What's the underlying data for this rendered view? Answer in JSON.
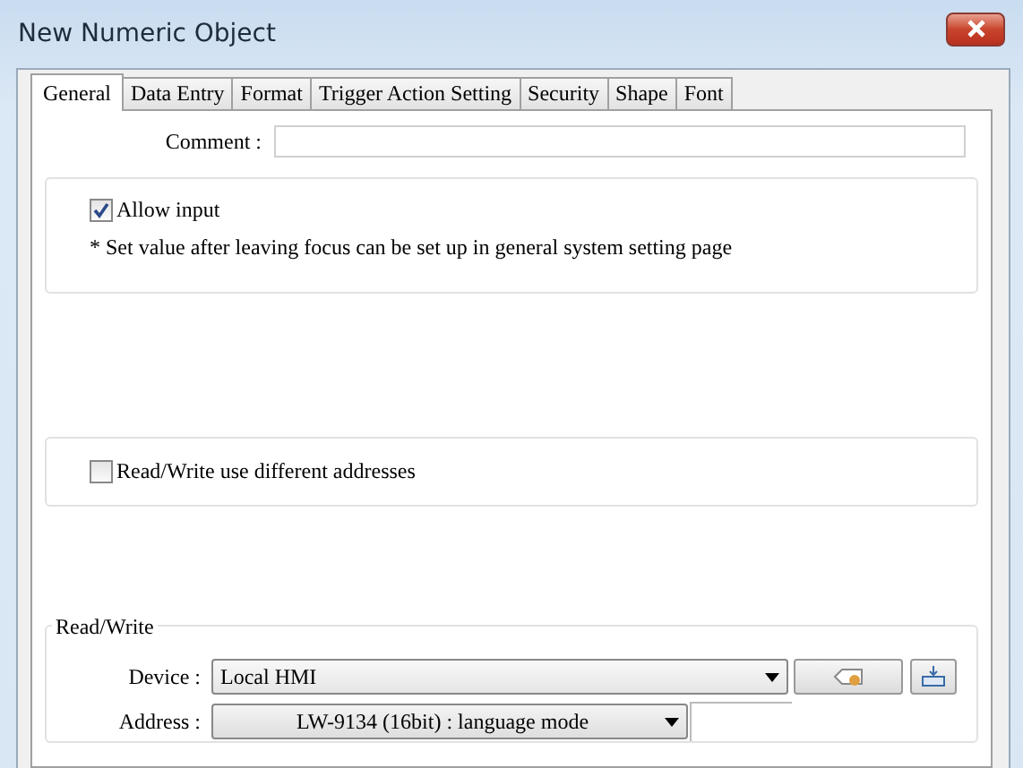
{
  "window": {
    "title": "New Numeric Object"
  },
  "tabs": [
    {
      "label": "General",
      "selected": true
    },
    {
      "label": "Data Entry",
      "selected": false
    },
    {
      "label": "Format",
      "selected": false
    },
    {
      "label": "Trigger Action Setting",
      "selected": false
    },
    {
      "label": "Security",
      "selected": false
    },
    {
      "label": "Shape",
      "selected": false
    },
    {
      "label": "Font",
      "selected": false
    }
  ],
  "comment": {
    "label": "Comment :"
  },
  "allow_input": {
    "label": "Allow input",
    "checked": true,
    "note": "* Set value after leaving focus can be set up in general system setting page"
  },
  "different_addresses": {
    "label": "Read/Write use different addresses",
    "checked": false
  },
  "read_write": {
    "legend": "Read/Write",
    "device_label": "Device :",
    "device": "Local HMI",
    "address_label": "Address :",
    "address": "LW-9134 (16bit) : language mode"
  }
}
